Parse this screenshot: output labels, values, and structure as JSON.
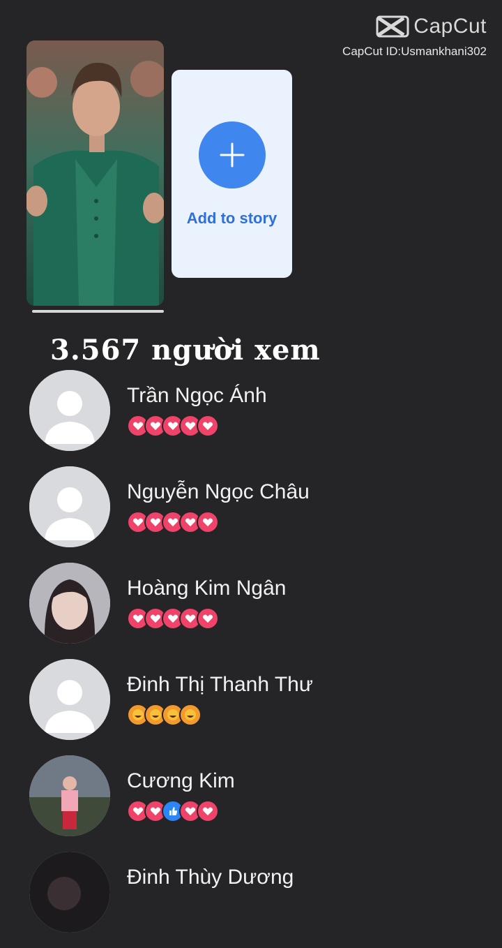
{
  "watermark": {
    "brand": "CapCut",
    "id_text": "CapCut ID:Usmankhani302"
  },
  "story": {
    "add_label": "Add to story",
    "plus_icon": "plus-icon"
  },
  "viewers": {
    "count_text": "3.567 người xem",
    "list": [
      {
        "name": "Trần Ngọc Ánh",
        "avatar": "default",
        "reactions": [
          "love",
          "love",
          "love",
          "love",
          "love"
        ]
      },
      {
        "name": "Nguyễn Ngọc Châu",
        "avatar": "default",
        "reactions": [
          "love",
          "love",
          "love",
          "love",
          "love"
        ]
      },
      {
        "name": "Hoàng Kim Ngân",
        "avatar": "photo-girl",
        "reactions": [
          "love",
          "love",
          "love",
          "love",
          "love"
        ]
      },
      {
        "name": "Đinh Thị Thanh Thư",
        "avatar": "default",
        "reactions": [
          "haha",
          "haha",
          "haha",
          "haha"
        ]
      },
      {
        "name": "Cương Kim",
        "avatar": "photo-outdoor",
        "reactions": [
          "love",
          "love",
          "like",
          "love",
          "love"
        ]
      },
      {
        "name": "Đinh Thùy Dương",
        "avatar": "photo-dark",
        "reactions": []
      }
    ]
  },
  "colors": {
    "background": "#252427",
    "accent_blue": "#3f86ee",
    "love_red": "#f0436a",
    "like_blue": "#2d86f5",
    "haha_orange": "#f29a2e"
  }
}
